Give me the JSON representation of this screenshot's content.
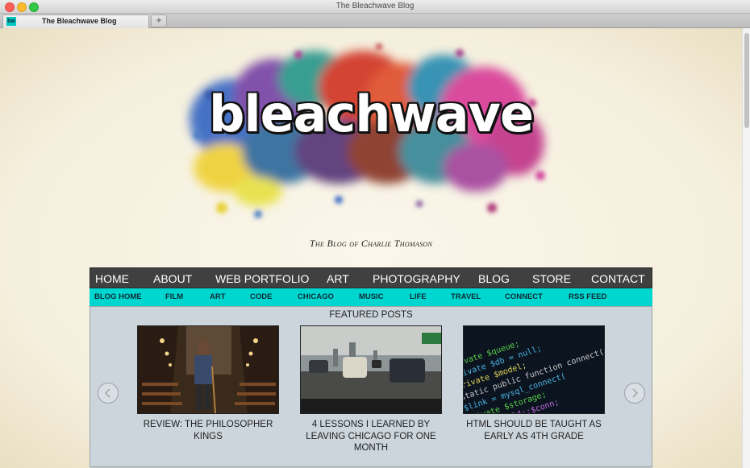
{
  "window": {
    "title": "The Bleachwave Blog"
  },
  "tab": {
    "title": "The Bleachwave Blog",
    "favicon": "bw",
    "new_tab": "+"
  },
  "site": {
    "logo": "bleachwave",
    "tagline": "The Blog of Charlie Thomason"
  },
  "main_nav": [
    "HOME",
    "ABOUT",
    "WEB PORTFOLIO",
    "ART",
    "PHOTOGRAPHY",
    "BLOG",
    "STORE",
    "CONTACT"
  ],
  "sub_nav": [
    "BLOG HOME",
    "FILM",
    "ART",
    "CODE",
    "CHICAGO",
    "MUSIC",
    "LIFE",
    "TRAVEL",
    "CONNECT",
    "RSS FEED"
  ],
  "featured": {
    "heading": "FEATURED POSTS",
    "posts": [
      {
        "title": "REVIEW: THE PHILOSOPHER KINGS",
        "image": "chapel-interior-photo"
      },
      {
        "title": "4 LESSONS I LEARNED BY LEAVING CHICAGO FOR ONE MONTH",
        "image": "highway-traffic-photo"
      },
      {
        "title": "HTML SHOULD BE TAUGHT AS EARLY AS 4TH GRADE",
        "image": "code-screen-photo"
      }
    ],
    "prev_icon": "chevron-left-circle-icon",
    "next_icon": "chevron-right-circle-icon"
  },
  "colors": {
    "main_nav_bg": "#404040",
    "sub_nav_bg": "#00d6d0",
    "featured_bg": "#ccd5dc",
    "page_bg": "#f6f1e3"
  }
}
